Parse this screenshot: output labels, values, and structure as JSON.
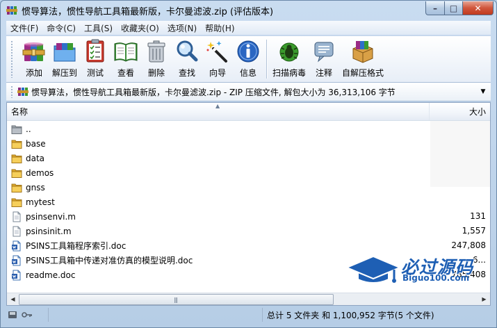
{
  "window": {
    "title": "惯导算法，惯性导航工具箱最新版，卡尔曼滤波.zip (评估版本)",
    "controls": {
      "minimize": "–",
      "maximize": "□",
      "close": "✕"
    }
  },
  "menu": [
    {
      "id": "file",
      "label": "文件(F)"
    },
    {
      "id": "commands",
      "label": "命令(C)"
    },
    {
      "id": "tools",
      "label": "工具(S)"
    },
    {
      "id": "favorites",
      "label": "收藏夹(O)"
    },
    {
      "id": "options",
      "label": "选项(N)"
    },
    {
      "id": "help",
      "label": "帮助(H)"
    }
  ],
  "toolbar": [
    {
      "id": "add",
      "label": "添加",
      "icon": "add-archive-icon"
    },
    {
      "id": "extract",
      "label": "解压到",
      "icon": "extract-folder-icon"
    },
    {
      "id": "test",
      "label": "测试",
      "icon": "test-checklist-icon"
    },
    {
      "id": "view",
      "label": "查看",
      "icon": "view-book-icon"
    },
    {
      "id": "delete",
      "label": "删除",
      "icon": "trash-icon"
    },
    {
      "id": "find",
      "label": "查找",
      "icon": "magnifier-icon"
    },
    {
      "id": "wizard",
      "label": "向导",
      "icon": "wizard-wand-icon"
    },
    {
      "id": "info",
      "label": "信息",
      "icon": "info-icon"
    },
    {
      "id": "scan",
      "label": "扫描病毒",
      "icon": "virus-scan-icon"
    },
    {
      "id": "comment",
      "label": "注释",
      "icon": "comment-icon"
    },
    {
      "id": "sfx",
      "label": "自解压格式",
      "icon": "sfx-box-icon"
    }
  ],
  "address": {
    "text": "惯导算法，惯性导航工具箱最新版，卡尔曼滤波.zip - ZIP 压缩文件, 解包大小为 36,313,106 字节"
  },
  "columns": {
    "name": "名称",
    "size": "大小"
  },
  "files": [
    {
      "name": "..",
      "size": "",
      "type": "parent"
    },
    {
      "name": "base",
      "size": "",
      "type": "folder"
    },
    {
      "name": "data",
      "size": "",
      "type": "folder"
    },
    {
      "name": "demos",
      "size": "",
      "type": "folder"
    },
    {
      "name": "gnss",
      "size": "",
      "type": "folder"
    },
    {
      "name": "mytest",
      "size": "",
      "type": "folder"
    },
    {
      "name": "psinsenvi.m",
      "size": "131",
      "type": "file"
    },
    {
      "name": "psinsinit.m",
      "size": "1,557",
      "type": "file"
    },
    {
      "name": "PSINS工具箱程序索引.doc",
      "size": "247,808",
      "type": "doc"
    },
    {
      "name": "PSINS工具箱中传递对准仿真的模型说明.doc",
      "size": "6...",
      "type": "doc"
    },
    {
      "name": "readme.doc",
      "size": "785,408",
      "type": "doc"
    }
  ],
  "status": {
    "summary": "总计 5 文件夹 和 1,100,952 字节(5 个文件)"
  },
  "watermark": {
    "title": "必过源码",
    "subtitle": "Biguo100.com"
  }
}
